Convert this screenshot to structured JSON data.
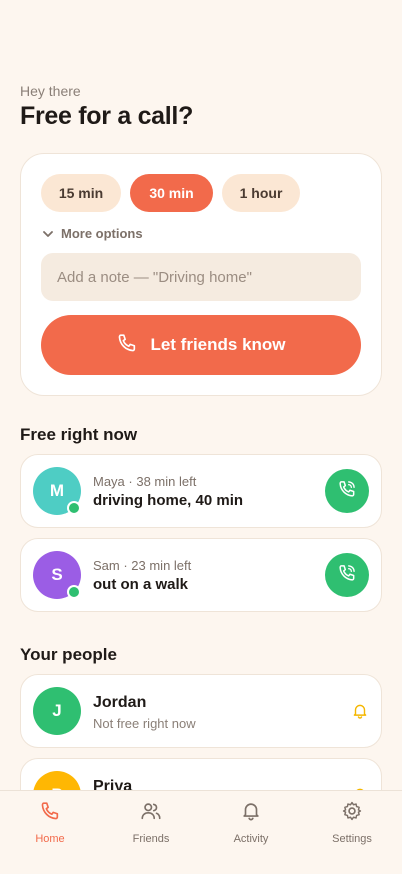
{
  "header": {
    "greeting": "Hey there",
    "title": "Free for a call?"
  },
  "availability": {
    "durations": [
      {
        "label": "15 min",
        "selected": false
      },
      {
        "label": "30 min",
        "selected": true
      },
      {
        "label": "1 hour",
        "selected": false
      }
    ],
    "more_options_label": "More options",
    "note_placeholder": "Add a note — \"Driving home\"",
    "cta_label": "Let friends know"
  },
  "free_now": {
    "title": "Free right now",
    "items": [
      {
        "initial": "M",
        "meta": "Maya · 38 min left",
        "status": "driving home, 40 min",
        "avatar_color": "#4ecdc4",
        "online": true
      },
      {
        "initial": "S",
        "meta": "Sam · 23 min left",
        "status": "out on a walk",
        "avatar_color": "#9b5de5",
        "online": true
      }
    ]
  },
  "people": {
    "title": "Your people",
    "items": [
      {
        "initial": "J",
        "name": "Jordan",
        "sub": "Not free right now",
        "avatar_color": "#2fbf71"
      },
      {
        "initial": "P",
        "name": "Priya",
        "sub": "",
        "avatar_color": "#ffb703"
      }
    ]
  },
  "tabbar": {
    "tabs": [
      {
        "label": "Home",
        "icon": "phone-icon",
        "active": true
      },
      {
        "label": "Friends",
        "icon": "users-icon",
        "active": false
      },
      {
        "label": "Activity",
        "icon": "bell-icon",
        "active": false
      },
      {
        "label": "Settings",
        "icon": "gear-icon",
        "active": false
      }
    ]
  },
  "colors": {
    "accent": "#f26a4b",
    "online": "#2fbf71",
    "chip": "#fbe7d4",
    "bell": "#f5b700"
  }
}
